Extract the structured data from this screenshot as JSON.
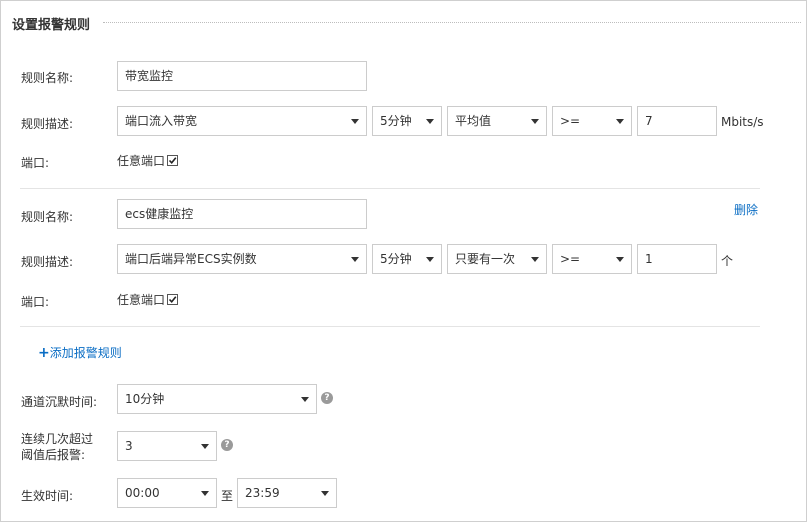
{
  "section": {
    "title": "设置报警规则"
  },
  "rules": [
    {
      "name_label": "规则名称:",
      "name_value": "带宽监控",
      "desc_label": "规则描述:",
      "metric": "端口流入带宽",
      "period": "5分钟",
      "statistic": "平均值",
      "operator": ">=",
      "threshold": "7",
      "unit": "Mbits/s",
      "port_label": "端口:",
      "port_value": "任意端口",
      "port_checked": true
    },
    {
      "name_label": "规则名称:",
      "name_value": "ecs健康监控",
      "delete_label": "删除",
      "desc_label": "规则描述:",
      "metric": "端口后端异常ECS实例数",
      "period": "5分钟",
      "statistic": "只要有一次",
      "operator": ">=",
      "threshold": "1",
      "unit": "个",
      "port_label": "端口:",
      "port_value": "任意端口",
      "port_checked": true
    }
  ],
  "add_rule": {
    "icon": "plus-icon",
    "label": "添加报警规则"
  },
  "silence": {
    "label": "通道沉默时间:",
    "value": "10分钟",
    "help_icon": "question-icon"
  },
  "consecutive": {
    "label_line1": "连续几次超过",
    "label_line2": "阈值后报警:",
    "value": "3",
    "help_icon": "question-icon"
  },
  "effective": {
    "label": "生效时间:",
    "start": "00:00",
    "separator": "至",
    "end": "23:59"
  },
  "colors": {
    "link": "#0a6dc4",
    "border": "#cccccc",
    "help": "#9a9a9a"
  }
}
